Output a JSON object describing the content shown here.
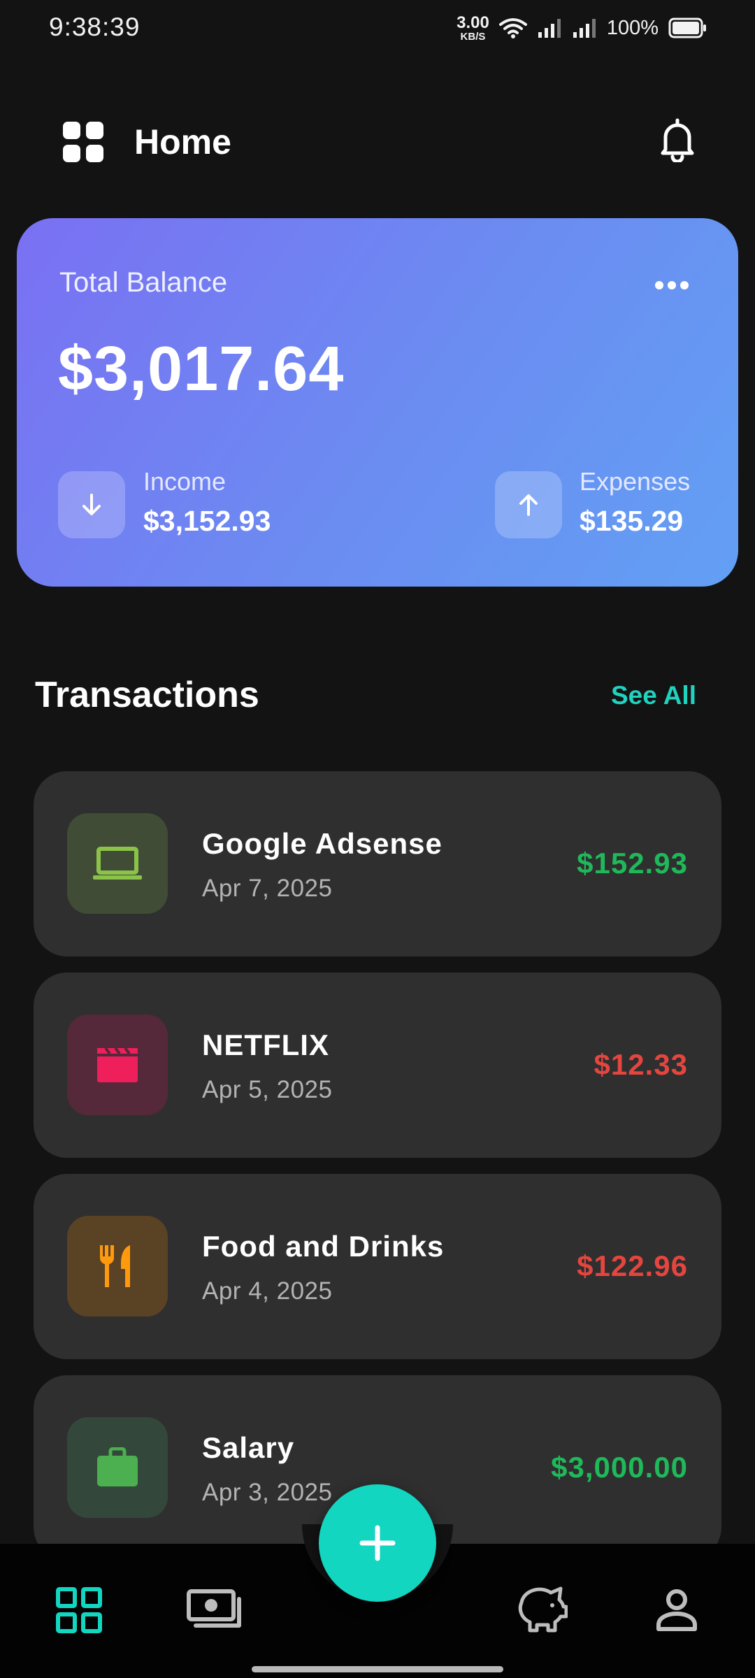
{
  "status_bar": {
    "time": "9:38:39",
    "net_speed_value": "3.00",
    "net_speed_unit": "KB/S",
    "battery": "100%"
  },
  "header": {
    "title": "Home",
    "menu_icon": "grid-menu-icon",
    "notification_icon": "bell-icon"
  },
  "balance_card": {
    "label": "Total Balance",
    "amount": "$3,017.64",
    "income_label": "Income",
    "income_value": "$3,152.93",
    "expenses_label": "Expenses",
    "expenses_value": "$135.29",
    "gradient_start": "#7a70f3",
    "gradient_end": "#62a0f4"
  },
  "transactions": {
    "title": "Transactions",
    "see_all": "See All",
    "items": [
      {
        "name": "Google Adsense",
        "date": "Apr 7, 2025",
        "amount": "$152.93",
        "type": "income",
        "icon": "laptop-icon",
        "icon_color": "#8bc34a"
      },
      {
        "name": "NETFLIX",
        "date": "Apr 5, 2025",
        "amount": "$12.33",
        "type": "expense",
        "icon": "clapperboard-icon",
        "icon_color": "#ef1f5c"
      },
      {
        "name": "Food and Drinks",
        "date": "Apr 4, 2025",
        "amount": "$122.96",
        "type": "expense",
        "icon": "fork-knife-icon",
        "icon_color": "#ff9a0f"
      },
      {
        "name": "Salary",
        "date": "Apr 3, 2025",
        "amount": "$3,000.00",
        "type": "income",
        "icon": "briefcase-icon",
        "icon_color": "#4caf50"
      }
    ]
  },
  "colors": {
    "accent": "#12d6c0",
    "income": "#1fb95a",
    "expense": "#e4463f",
    "card_bg": "#2f2f2f",
    "page_bg": "#131313"
  },
  "bottom_nav": {
    "items": [
      {
        "icon": "dashboard-icon",
        "active": true
      },
      {
        "icon": "wallet-icon",
        "active": false
      },
      {
        "icon": "piggy-bank-icon",
        "active": false
      },
      {
        "icon": "profile-icon",
        "active": false
      }
    ],
    "fab_icon": "plus-icon"
  }
}
